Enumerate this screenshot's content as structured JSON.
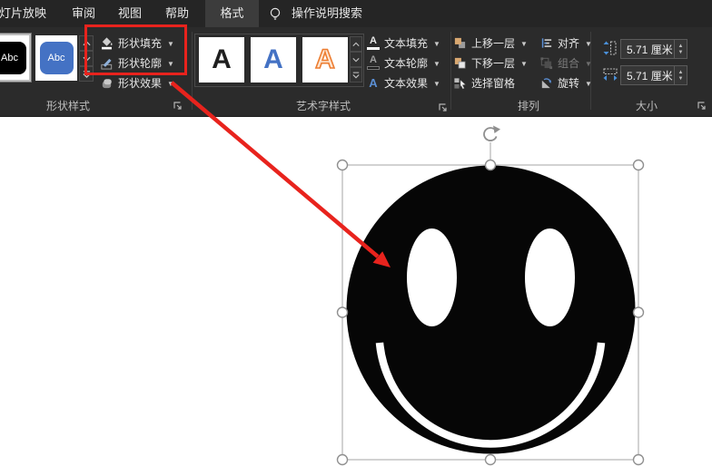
{
  "colors": {
    "accent_red": "#e8231d",
    "shape_blue": "#4472c4",
    "wordart_orange": "#ed7d31",
    "ribbon_bg": "#2b2b2b",
    "tabbar_bg": "#252525"
  },
  "tabbar": {
    "tabs": [
      {
        "label": "幻灯片放映"
      },
      {
        "label": "审阅"
      },
      {
        "label": "视图"
      },
      {
        "label": "帮助"
      },
      {
        "label": "格式",
        "active": true
      }
    ],
    "assistant_label": "操作说明搜索"
  },
  "ribbon": {
    "shape_styles": {
      "label": "形状样式",
      "gallery": [
        {
          "text": "Abc",
          "style": "black",
          "selected": true
        },
        {
          "text": "Abc",
          "style": "blue",
          "selected": false
        }
      ],
      "fill_label": "形状填充",
      "outline_label": "形状轮廓",
      "effects_label": "形状效果"
    },
    "wordart": {
      "label": "艺术字样式",
      "gallery": [
        {
          "letter": "A",
          "style": "black"
        },
        {
          "letter": "A",
          "style": "blue"
        },
        {
          "letter": "A",
          "style": "orange-outline"
        }
      ],
      "text_fill_label": "文本填充",
      "text_outline_label": "文本轮廓",
      "text_effects_label": "文本效果"
    },
    "arrange": {
      "label": "排列",
      "bring_forward_label": "上移一层",
      "send_backward_label": "下移一层",
      "selection_pane_label": "选择窗格",
      "align_label": "对齐",
      "group_label": "组合",
      "group_disabled": true,
      "rotate_label": "旋转"
    },
    "size": {
      "label": "大小",
      "height_value": "5.71 厘米",
      "width_value": "5.71 厘米"
    }
  }
}
